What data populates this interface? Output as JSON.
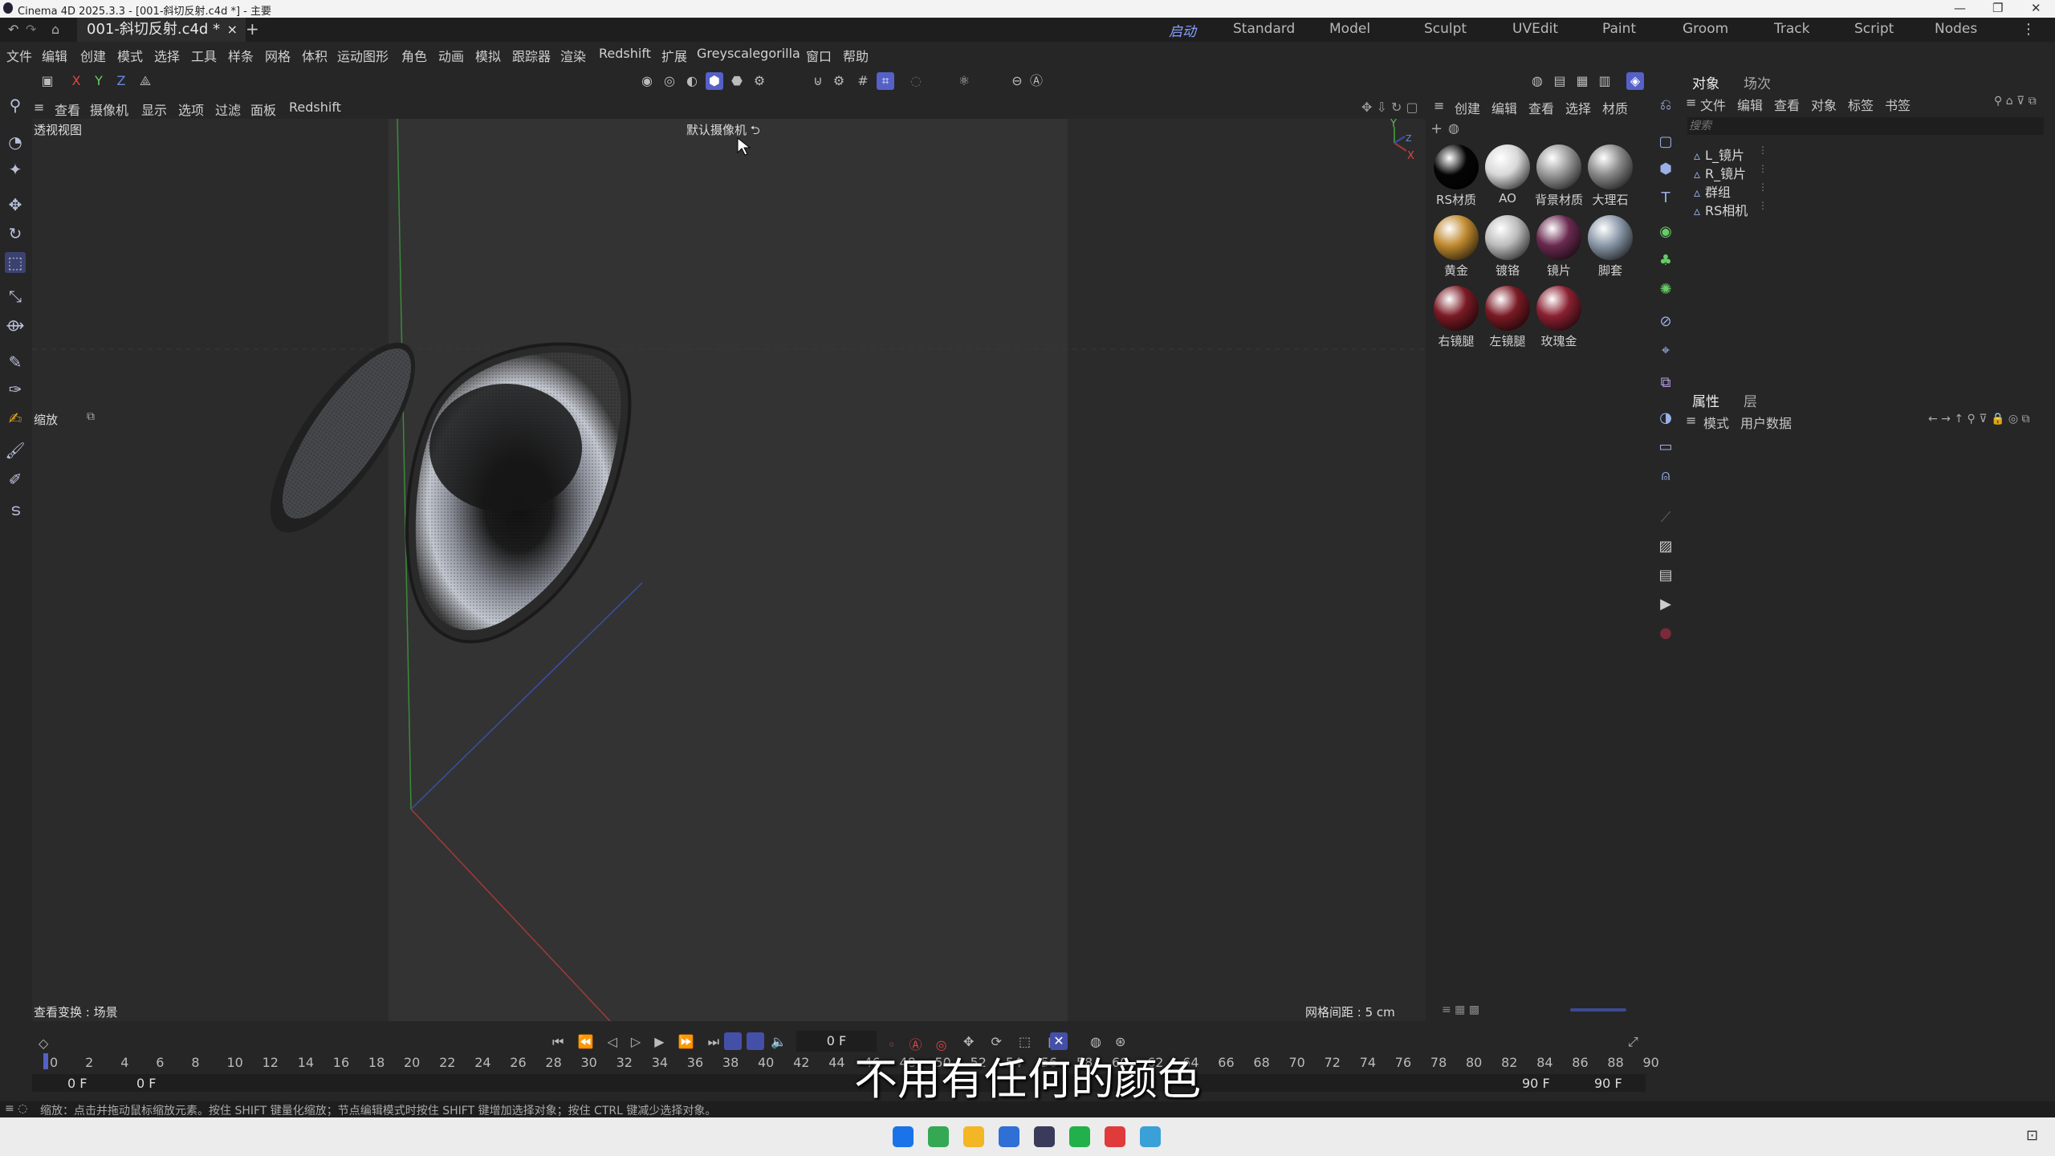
{
  "window": {
    "title": "Cinema 4D 2025.3.3 - [001-斜切反射.c4d *] - 主要"
  },
  "doc_tab": {
    "label": "001-斜切反射.c4d *",
    "close": "×",
    "add": "+"
  },
  "layouts": [
    "启动",
    "Standard",
    "Model",
    "Sculpt",
    "UVEdit",
    "Paint",
    "Groom",
    "Track",
    "Script",
    "Nodes"
  ],
  "menu": [
    "文件",
    "编辑",
    "创建",
    "模式",
    "选择",
    "工具",
    "样条",
    "网格",
    "体积",
    "运动图形",
    "角色",
    "动画",
    "模拟",
    "跟踪器",
    "渲染",
    "Redshift",
    "扩展",
    "Greyscalegorilla",
    "窗口",
    "帮助"
  ],
  "axis_buttons": [
    "X",
    "Y",
    "Z"
  ],
  "viewport": {
    "menu": [
      "查看",
      "摄像机",
      "显示",
      "选项",
      "过滤",
      "面板",
      "Redshift"
    ],
    "view_name": "透视视图",
    "camera": "默认摄像机",
    "zoom_label": "缩放",
    "view_transform": "查看变换 : 场景",
    "grid_spacing": "网格间距 : 5 cm"
  },
  "materials": {
    "menu": [
      "创建",
      "编辑",
      "查看",
      "选择",
      "材质"
    ],
    "items": [
      {
        "name": "RS材质",
        "color": "#050505"
      },
      {
        "name": "AO",
        "color": "#d8d8d8"
      },
      {
        "name": "背景材质",
        "color": "#9a9a9a"
      },
      {
        "name": "大理石",
        "color": "#8a8a8a"
      },
      {
        "name": "黄金",
        "color": "#c08a30"
      },
      {
        "name": "镀铬",
        "color": "#bcbcbc"
      },
      {
        "name": "镜片",
        "color": "#6a2a50"
      },
      {
        "name": "脚套",
        "color": "#8a98a8"
      },
      {
        "name": "右镜腿",
        "color": "#7a1a24"
      },
      {
        "name": "左镜腿",
        "color": "#7a1a24"
      },
      {
        "name": "玫瑰金",
        "color": "#8a2030"
      }
    ]
  },
  "object_manager": {
    "tabs": [
      "对象",
      "场次"
    ],
    "menu": [
      "文件",
      "编辑",
      "查看",
      "对象",
      "标签",
      "书签"
    ],
    "search_placeholder": "搜索",
    "objects": [
      "L_镜片",
      "R_镜片",
      "群组",
      "RS相机"
    ]
  },
  "attributes": {
    "tabs": [
      "属性",
      "层"
    ],
    "menu": [
      "模式",
      "用户数据"
    ]
  },
  "timeline": {
    "current_frame": "0 F",
    "ticks": [
      "0",
      "2",
      "4",
      "6",
      "8",
      "10",
      "12",
      "14",
      "16",
      "18",
      "20",
      "22",
      "24",
      "26",
      "28",
      "30",
      "32",
      "34",
      "36",
      "38",
      "40",
      "42",
      "44",
      "46",
      "48",
      "50",
      "52",
      "54",
      "56",
      "58",
      "60",
      "62",
      "64",
      "66",
      "68",
      "70",
      "72",
      "74",
      "76",
      "78",
      "80",
      "82",
      "84",
      "86",
      "88",
      "90"
    ],
    "start": "0 F",
    "start2": "0 F",
    "end": "90 F",
    "end2": "90 F"
  },
  "status": "缩放：点击并拖动鼠标缩放元素。按住 SHIFT 键量化缩放；节点编辑模式时按住 SHIFT 键增加选择对象；按住 CTRL 键减少选择对象。",
  "subtitle": "不用有任何的颜色",
  "taskbar_icons": [
    {
      "name": "windows-start-icon",
      "color": "#1a73e8"
    },
    {
      "name": "chrome-icon",
      "color": "#34a853"
    },
    {
      "name": "file-explorer-icon",
      "color": "#f3b624"
    },
    {
      "name": "app-blue-icon",
      "color": "#2f6fd6"
    },
    {
      "name": "cinema4d-icon",
      "color": "#3a3a5a"
    },
    {
      "name": "app-green-icon",
      "color": "#22b04a"
    },
    {
      "name": "app-red-icon",
      "color": "#e03a3a"
    },
    {
      "name": "notepad-icon",
      "color": "#3aa0d8"
    }
  ]
}
